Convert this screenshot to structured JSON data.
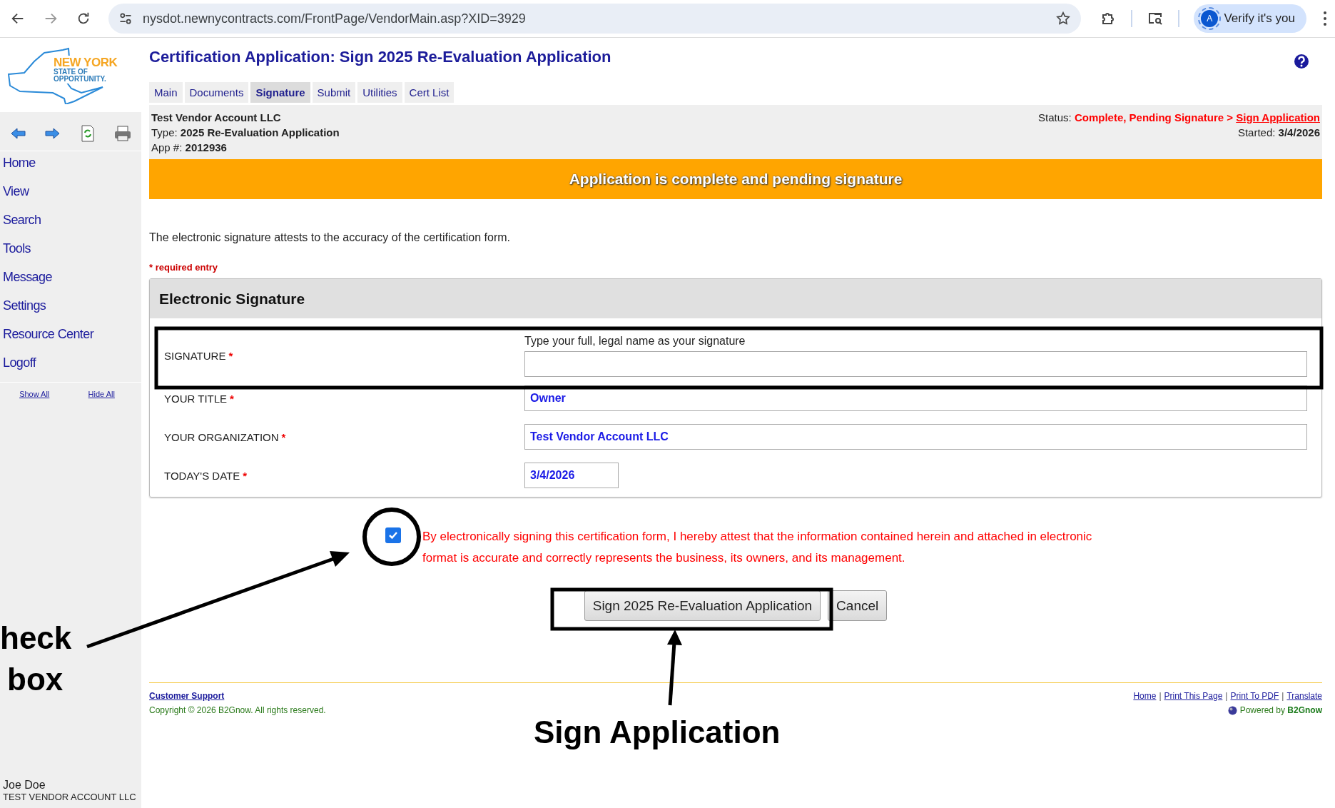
{
  "browser": {
    "url": "nysdot.newnycontracts.com/FrontPage/VendorMain.asp?XID=3929",
    "profile_initial": "A",
    "profile_label": "Verify it's you"
  },
  "logo": {
    "line_1": "NEW YORK",
    "line_2": "STATE OF",
    "line_3": "OPPORTUNITY."
  },
  "sidebar": {
    "items": [
      "Home",
      "View",
      "Search",
      "Tools",
      "Message",
      "Settings",
      "Resource Center",
      "Logoff"
    ],
    "links": [
      "Show All",
      "Hide All"
    ],
    "user_name": "Joe Doe",
    "user_org": "TEST VENDOR ACCOUNT LLC"
  },
  "page": {
    "title": "Certification Application: Sign 2025 Re-Evaluation Application",
    "tabs": [
      {
        "label": "Main",
        "selected": false
      },
      {
        "label": "Documents",
        "selected": false
      },
      {
        "label": "Signature",
        "selected": true
      },
      {
        "label": "Submit",
        "selected": false
      },
      {
        "label": "Utilities",
        "selected": false
      },
      {
        "label": "Cert List",
        "selected": false
      }
    ]
  },
  "application": {
    "vendor": "Test Vendor Account LLC",
    "type_label": "Type:",
    "type": "2025 Re-Evaluation Application",
    "app_label": "App #:",
    "app_number": "2012936",
    "status_label": "Status:",
    "status": "Complete, Pending Signature >",
    "status_link": "Sign Application",
    "started_label": "Started:",
    "started": "3/4/2026"
  },
  "banner": "Application is complete and pending signature",
  "intro": "The electronic signature attests to the accuracy of the certification form.",
  "required_note": "* required entry",
  "form": {
    "title": "Electronic Signature",
    "required_mark": "*",
    "fields": [
      {
        "kind": "text",
        "label": "SIGNATURE",
        "required": true,
        "hint": "Type your full, legal name as your signature"
      },
      {
        "kind": "text",
        "label": "YOUR TITLE",
        "required": true,
        "value": "Owner"
      },
      {
        "kind": "text",
        "label": "YOUR ORGANIZATION",
        "required": true,
        "value": "Test Vendor Account LLC"
      },
      {
        "kind": "date",
        "label": "TODAY'S DATE",
        "required": true,
        "value": "3/4/2026"
      }
    ]
  },
  "attestation": {
    "checked": true,
    "text": "By electronically signing this certification form, I hereby attest that the information contained herein and attached in electronic format is accurate and correctly represents the business, its owners, and its management."
  },
  "buttons": [
    "Sign 2025 Re-Evaluation Application",
    "Cancel"
  ],
  "footer": {
    "support_link": "Customer Support",
    "copyright": "Copyright © 2026 B2Gnow. All rights reserved.",
    "links": [
      "Home",
      "Print This Page",
      "Print To PDF",
      "Translate"
    ],
    "separator": "|",
    "powered_label": "Powered by",
    "powered_brand": "B2Gnow"
  },
  "annotations": {
    "checkbox_label": [
      "heck",
      "box"
    ],
    "button_label": "Sign Application"
  }
}
